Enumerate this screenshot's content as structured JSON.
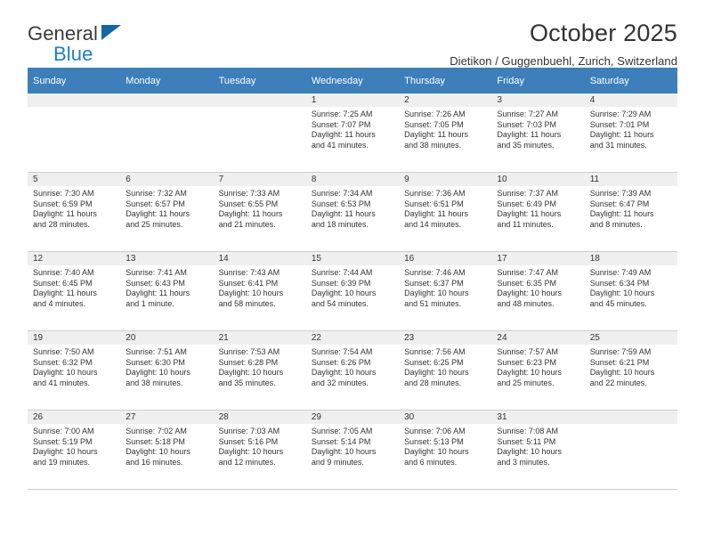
{
  "logo": {
    "word1": "General",
    "word2": "Blue",
    "triangle_color": "#1267ab",
    "blue_color": "#1b7fc4"
  },
  "header": {
    "title": "October 2025",
    "subtitle": "Dietikon / Guggenbuehl, Zurich, Switzerland",
    "header_bg": "#3c7fba"
  },
  "calendar": {
    "weekday_headers": [
      "Sunday",
      "Monday",
      "Tuesday",
      "Wednesday",
      "Thursday",
      "Friday",
      "Saturday"
    ],
    "labels": {
      "sunrise": "Sunrise:",
      "sunset": "Sunset:",
      "daylight": "Daylight:"
    },
    "weeks": [
      [
        {
          "day": "",
          "empty": true
        },
        {
          "day": "",
          "empty": true
        },
        {
          "day": "",
          "empty": true
        },
        {
          "day": "1",
          "sunrise": "Sunrise: 7:25 AM",
          "sunset": "Sunset: 7:07 PM",
          "daylight1": "Daylight: 11 hours",
          "daylight2": "and 41 minutes."
        },
        {
          "day": "2",
          "sunrise": "Sunrise: 7:26 AM",
          "sunset": "Sunset: 7:05 PM",
          "daylight1": "Daylight: 11 hours",
          "daylight2": "and 38 minutes."
        },
        {
          "day": "3",
          "sunrise": "Sunrise: 7:27 AM",
          "sunset": "Sunset: 7:03 PM",
          "daylight1": "Daylight: 11 hours",
          "daylight2": "and 35 minutes."
        },
        {
          "day": "4",
          "sunrise": "Sunrise: 7:29 AM",
          "sunset": "Sunset: 7:01 PM",
          "daylight1": "Daylight: 11 hours",
          "daylight2": "and 31 minutes."
        }
      ],
      [
        {
          "day": "5",
          "sunrise": "Sunrise: 7:30 AM",
          "sunset": "Sunset: 6:59 PM",
          "daylight1": "Daylight: 11 hours",
          "daylight2": "and 28 minutes."
        },
        {
          "day": "6",
          "sunrise": "Sunrise: 7:32 AM",
          "sunset": "Sunset: 6:57 PM",
          "daylight1": "Daylight: 11 hours",
          "daylight2": "and 25 minutes."
        },
        {
          "day": "7",
          "sunrise": "Sunrise: 7:33 AM",
          "sunset": "Sunset: 6:55 PM",
          "daylight1": "Daylight: 11 hours",
          "daylight2": "and 21 minutes."
        },
        {
          "day": "8",
          "sunrise": "Sunrise: 7:34 AM",
          "sunset": "Sunset: 6:53 PM",
          "daylight1": "Daylight: 11 hours",
          "daylight2": "and 18 minutes."
        },
        {
          "day": "9",
          "sunrise": "Sunrise: 7:36 AM",
          "sunset": "Sunset: 6:51 PM",
          "daylight1": "Daylight: 11 hours",
          "daylight2": "and 14 minutes."
        },
        {
          "day": "10",
          "sunrise": "Sunrise: 7:37 AM",
          "sunset": "Sunset: 6:49 PM",
          "daylight1": "Daylight: 11 hours",
          "daylight2": "and 11 minutes."
        },
        {
          "day": "11",
          "sunrise": "Sunrise: 7:39 AM",
          "sunset": "Sunset: 6:47 PM",
          "daylight1": "Daylight: 11 hours",
          "daylight2": "and 8 minutes."
        }
      ],
      [
        {
          "day": "12",
          "sunrise": "Sunrise: 7:40 AM",
          "sunset": "Sunset: 6:45 PM",
          "daylight1": "Daylight: 11 hours",
          "daylight2": "and 4 minutes."
        },
        {
          "day": "13",
          "sunrise": "Sunrise: 7:41 AM",
          "sunset": "Sunset: 6:43 PM",
          "daylight1": "Daylight: 11 hours",
          "daylight2": "and 1 minute."
        },
        {
          "day": "14",
          "sunrise": "Sunrise: 7:43 AM",
          "sunset": "Sunset: 6:41 PM",
          "daylight1": "Daylight: 10 hours",
          "daylight2": "and 58 minutes."
        },
        {
          "day": "15",
          "sunrise": "Sunrise: 7:44 AM",
          "sunset": "Sunset: 6:39 PM",
          "daylight1": "Daylight: 10 hours",
          "daylight2": "and 54 minutes."
        },
        {
          "day": "16",
          "sunrise": "Sunrise: 7:46 AM",
          "sunset": "Sunset: 6:37 PM",
          "daylight1": "Daylight: 10 hours",
          "daylight2": "and 51 minutes."
        },
        {
          "day": "17",
          "sunrise": "Sunrise: 7:47 AM",
          "sunset": "Sunset: 6:35 PM",
          "daylight1": "Daylight: 10 hours",
          "daylight2": "and 48 minutes."
        },
        {
          "day": "18",
          "sunrise": "Sunrise: 7:49 AM",
          "sunset": "Sunset: 6:34 PM",
          "daylight1": "Daylight: 10 hours",
          "daylight2": "and 45 minutes."
        }
      ],
      [
        {
          "day": "19",
          "sunrise": "Sunrise: 7:50 AM",
          "sunset": "Sunset: 6:32 PM",
          "daylight1": "Daylight: 10 hours",
          "daylight2": "and 41 minutes."
        },
        {
          "day": "20",
          "sunrise": "Sunrise: 7:51 AM",
          "sunset": "Sunset: 6:30 PM",
          "daylight1": "Daylight: 10 hours",
          "daylight2": "and 38 minutes."
        },
        {
          "day": "21",
          "sunrise": "Sunrise: 7:53 AM",
          "sunset": "Sunset: 6:28 PM",
          "daylight1": "Daylight: 10 hours",
          "daylight2": "and 35 minutes."
        },
        {
          "day": "22",
          "sunrise": "Sunrise: 7:54 AM",
          "sunset": "Sunset: 6:26 PM",
          "daylight1": "Daylight: 10 hours",
          "daylight2": "and 32 minutes."
        },
        {
          "day": "23",
          "sunrise": "Sunrise: 7:56 AM",
          "sunset": "Sunset: 6:25 PM",
          "daylight1": "Daylight: 10 hours",
          "daylight2": "and 28 minutes."
        },
        {
          "day": "24",
          "sunrise": "Sunrise: 7:57 AM",
          "sunset": "Sunset: 6:23 PM",
          "daylight1": "Daylight: 10 hours",
          "daylight2": "and 25 minutes."
        },
        {
          "day": "25",
          "sunrise": "Sunrise: 7:59 AM",
          "sunset": "Sunset: 6:21 PM",
          "daylight1": "Daylight: 10 hours",
          "daylight2": "and 22 minutes."
        }
      ],
      [
        {
          "day": "26",
          "sunrise": "Sunrise: 7:00 AM",
          "sunset": "Sunset: 5:19 PM",
          "daylight1": "Daylight: 10 hours",
          "daylight2": "and 19 minutes."
        },
        {
          "day": "27",
          "sunrise": "Sunrise: 7:02 AM",
          "sunset": "Sunset: 5:18 PM",
          "daylight1": "Daylight: 10 hours",
          "daylight2": "and 16 minutes."
        },
        {
          "day": "28",
          "sunrise": "Sunrise: 7:03 AM",
          "sunset": "Sunset: 5:16 PM",
          "daylight1": "Daylight: 10 hours",
          "daylight2": "and 12 minutes."
        },
        {
          "day": "29",
          "sunrise": "Sunrise: 7:05 AM",
          "sunset": "Sunset: 5:14 PM",
          "daylight1": "Daylight: 10 hours",
          "daylight2": "and 9 minutes."
        },
        {
          "day": "30",
          "sunrise": "Sunrise: 7:06 AM",
          "sunset": "Sunset: 5:13 PM",
          "daylight1": "Daylight: 10 hours",
          "daylight2": "and 6 minutes."
        },
        {
          "day": "31",
          "sunrise": "Sunrise: 7:08 AM",
          "sunset": "Sunset: 5:11 PM",
          "daylight1": "Daylight: 10 hours",
          "daylight2": "and 3 minutes."
        },
        {
          "day": "",
          "empty": true
        }
      ]
    ]
  }
}
